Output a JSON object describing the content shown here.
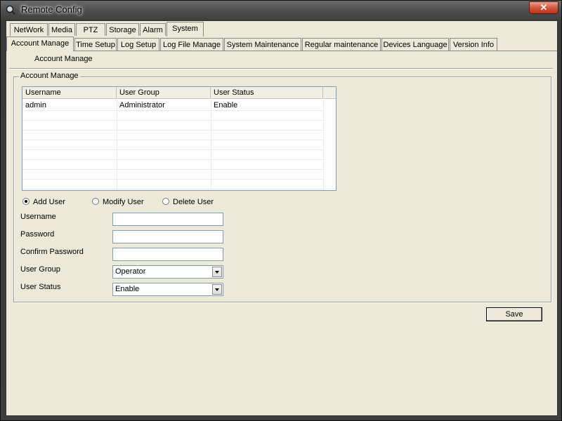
{
  "window": {
    "title": "Remote Config",
    "close_glyph": "✕"
  },
  "top_tabs": [
    "NetWork",
    "Media",
    "PTZ",
    "Storage",
    "Alarm",
    "System"
  ],
  "top_tabs_active": "System",
  "sub_tabs": [
    "Account Manage",
    "Time Setup",
    "Log Setup",
    "Log File Manage",
    "System Maintenance",
    "Regular maintenance",
    "Devices Language",
    "Version Info"
  ],
  "sub_tabs_active": "Account Manage",
  "section_label": "Account Manage",
  "group": {
    "legend": "Account Manage",
    "table": {
      "columns": [
        "Username",
        "User Group",
        "User Status"
      ],
      "rows": [
        [
          "admin",
          "Administrator",
          "Enable"
        ]
      ]
    },
    "mode": {
      "options": [
        "Add User",
        "Modify User",
        "Delete User"
      ],
      "selected": "Add User"
    },
    "form": {
      "username_label": "Username",
      "username_value": "",
      "password_label": "Password",
      "password_value": "",
      "confirm_label": "Confirm Password",
      "confirm_value": "",
      "group_label": "User Group",
      "group_value": "Operator",
      "status_label": "User Status",
      "status_value": "Enable"
    }
  },
  "save_label": "Save",
  "icons": {
    "app": "camera-search-icon",
    "dropdown": "chevron-down-icon"
  }
}
